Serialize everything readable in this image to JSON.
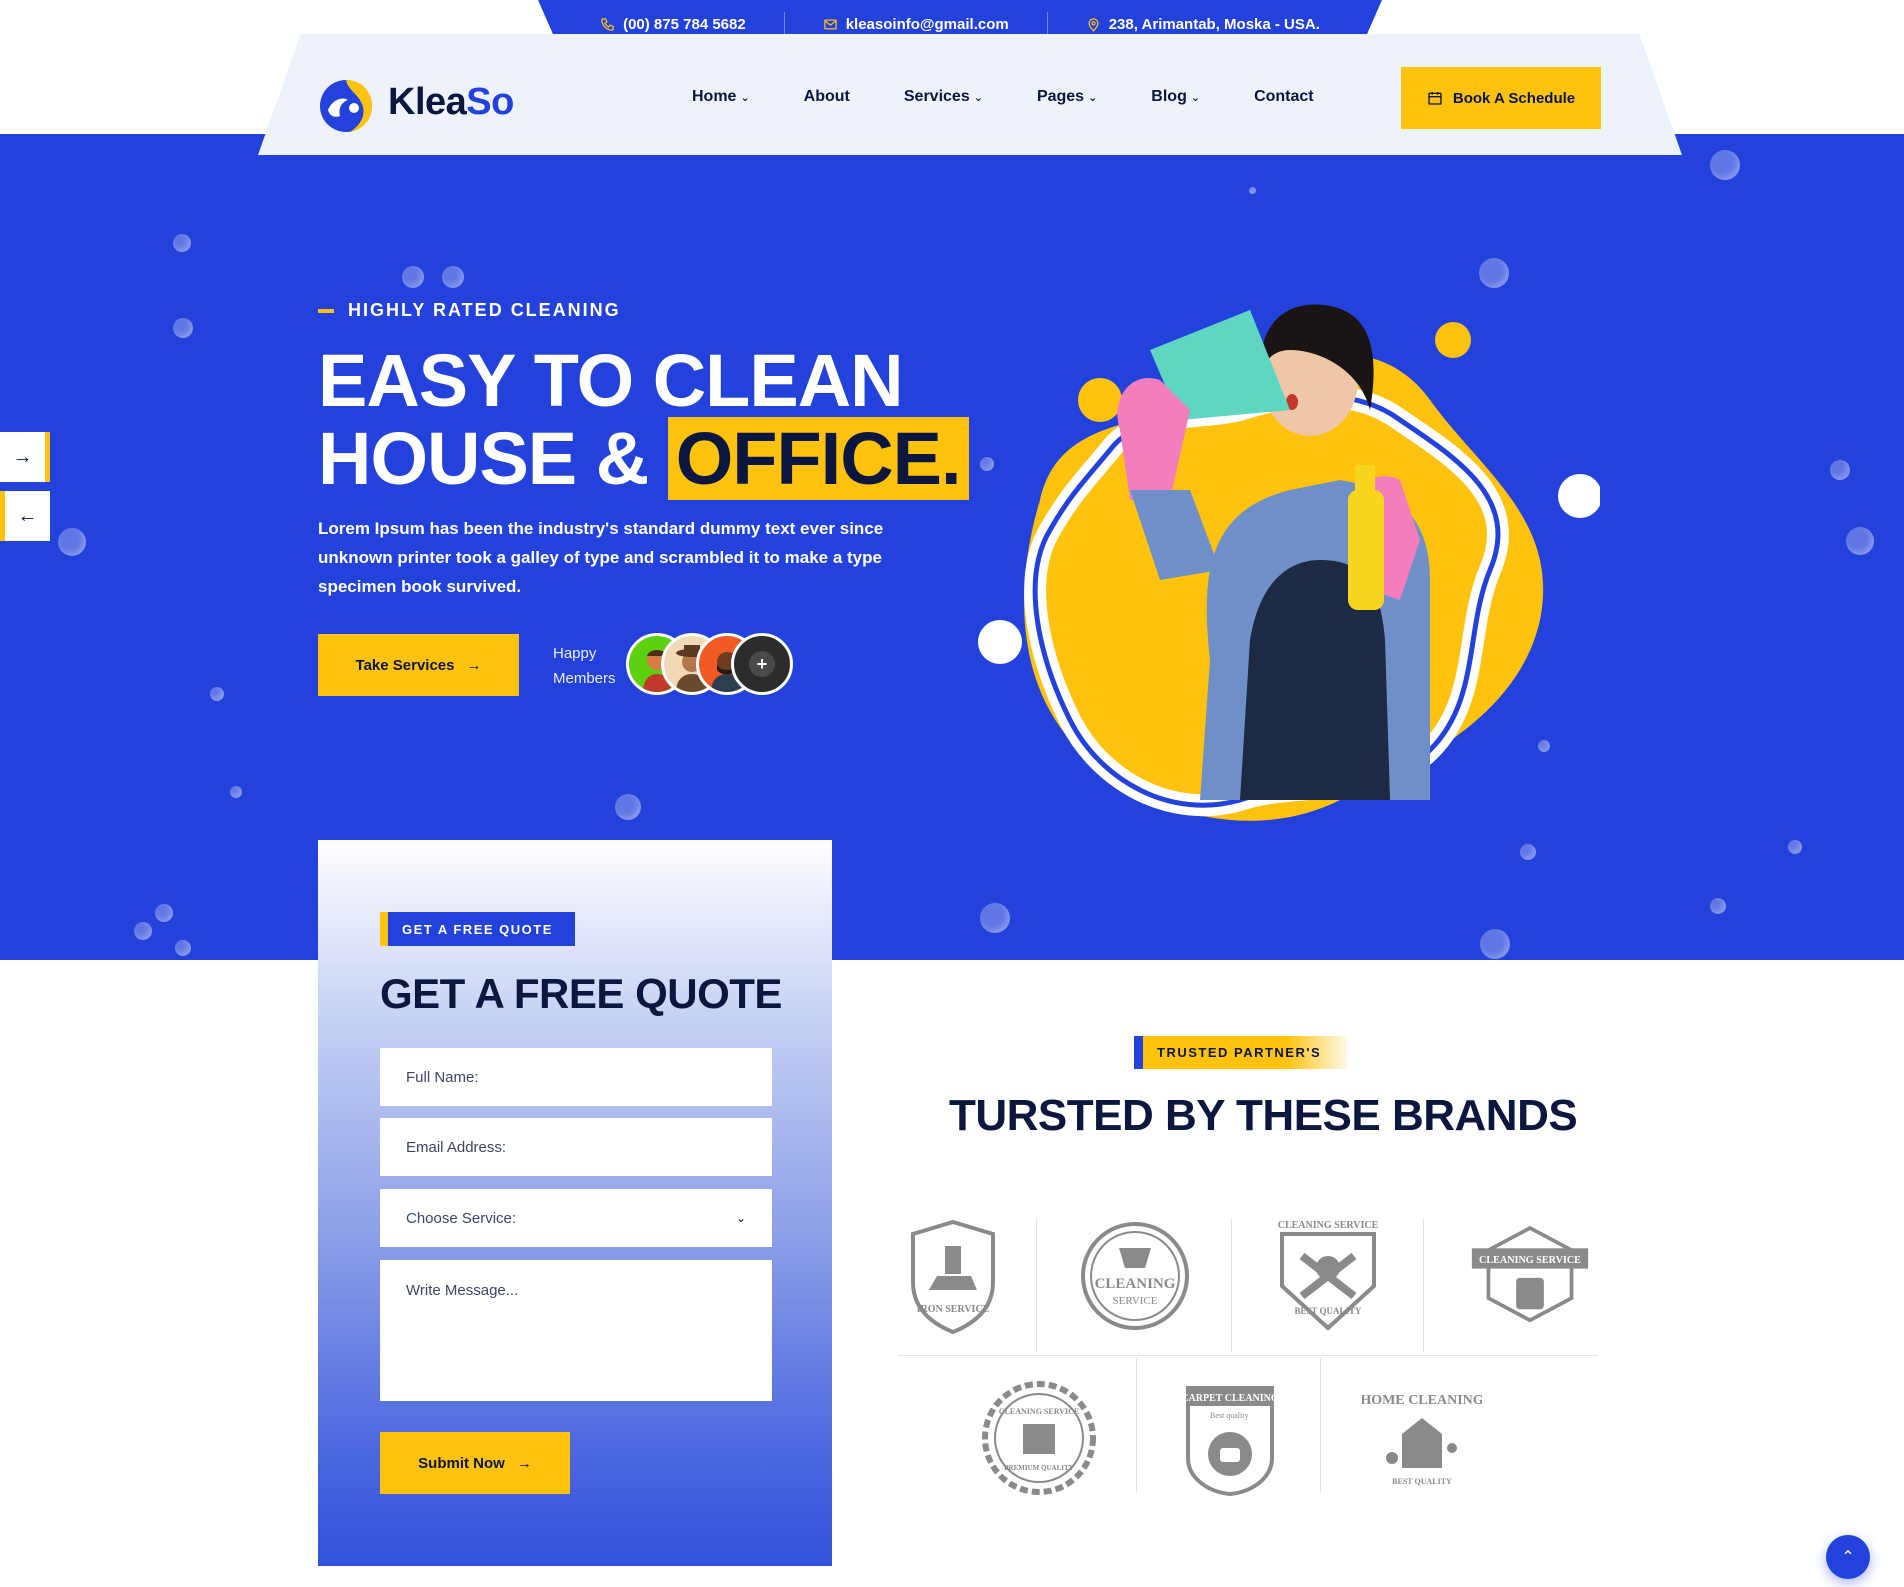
{
  "topbar": {
    "phone": "(00) 875 784 5682",
    "email": "kleasoinfo@gmail.com",
    "address": "238, Arimantab, Moska - USA."
  },
  "brand": {
    "name_part1": "Klea",
    "name_part2": "So"
  },
  "nav": {
    "items": [
      {
        "label": "Home",
        "has_dropdown": true
      },
      {
        "label": "About",
        "has_dropdown": false
      },
      {
        "label": "Services",
        "has_dropdown": true
      },
      {
        "label": "Pages",
        "has_dropdown": true
      },
      {
        "label": "Blog",
        "has_dropdown": true
      },
      {
        "label": "Contact",
        "has_dropdown": false
      }
    ],
    "cta_label": "Book A Schedule"
  },
  "hero": {
    "eyebrow": "HIGHLY RATED CLEANING",
    "title_line1": "EASY TO CLEAN",
    "title_line2_prefix": "HOUSE &",
    "title_highlight": "OFFICE.",
    "description": "Lorem Ipsum has been the industry's standard dummy text ever since unknown printer took a galley of type and scrambled it to make a type specimen book survived.",
    "button_label": "Take Services",
    "happy_line1": "Happy",
    "happy_line2": "Members",
    "avatar_more": "+"
  },
  "quote": {
    "badge": "GET A FREE QUOTE",
    "title": "GET A FREE QUOTE",
    "name_placeholder": "Full Name:",
    "email_placeholder": "Email Address:",
    "service_placeholder": "Choose Service:",
    "message_placeholder": "Write Message...",
    "submit_label": "Submit Now"
  },
  "brands": {
    "badge": "TRUSTED PARTNER'S",
    "title": "TURSTED BY THESE BRANDS",
    "logos": [
      {
        "top": "IRON SERVICE"
      },
      {
        "top": "CLEANING",
        "bottom": "SERVICE"
      },
      {
        "top": "CLEANING SERVICE",
        "bottom": "BEST QUALITY"
      },
      {
        "top": "CLEANING SERVICE"
      },
      {
        "top": "CLEANING SERVICE",
        "bottom": "PREMIUM QUALITY"
      },
      {
        "top": "CARPET CLEANING",
        "bottom": "Best quality"
      },
      {
        "top": "HOME CLEANING",
        "bottom": "BEST QUALITY"
      }
    ]
  },
  "colors": {
    "primary": "#2342dc",
    "accent": "#ffc20e",
    "dark": "#0c1740"
  }
}
